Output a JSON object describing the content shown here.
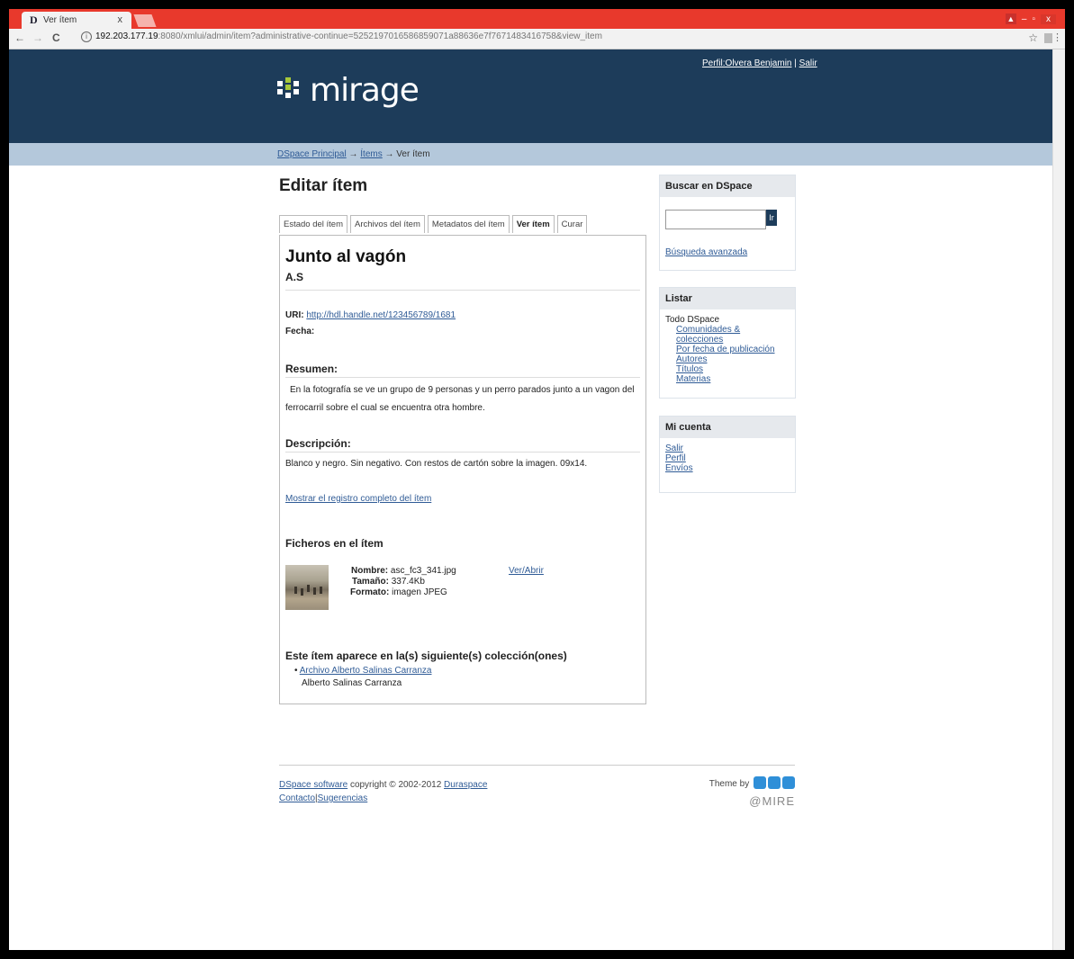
{
  "browser": {
    "tab_title": "Ver ítem",
    "tab_favicon": "D",
    "tab_close": "x",
    "url_host": "192.203.177.19",
    "url_rest": ":8080/xmlui/admin/item?administrative-continue=5252197016586859071a88636e7f7671483416758&view_item",
    "back": "←",
    "forward": "→",
    "reload": "C",
    "star": "☆",
    "menu": "⋮",
    "win_min": "–",
    "win_max": "▫",
    "win_close": "x",
    "colors": {
      "titlebar": "#e8392c",
      "header": "#1d3c5a",
      "trail": "#b4c8db"
    }
  },
  "header": {
    "logo_text": "mirage",
    "profile_link": "Perfil:Olvera Benjamin",
    "separator": "|",
    "logout_link": "Salir"
  },
  "trail": {
    "home": "DSpace Principal",
    "arrow": "→",
    "items": "Ítems",
    "current": "Ver ítem"
  },
  "main": {
    "title": "Editar ítem",
    "tabs": [
      {
        "label": "Estado del ítem"
      },
      {
        "label": "Archivos del ítem"
      },
      {
        "label": "Metadatos del ítem"
      },
      {
        "label": "Ver ítem"
      },
      {
        "label": "Curar"
      }
    ],
    "item_title": "Junto al vagón",
    "item_author": "A.S",
    "uri_label": "URI:",
    "uri_value": "http://hdl.handle.net/123456789/1681",
    "date_label": "Fecha:",
    "abstract_heading": "Resumen:",
    "abstract_text": "En la fotografía se ve un grupo de 9 personas y un perro parados junto a un vagon del ferrocarril sobre el cual se encuentra otra hombre.",
    "description_heading": "Descripción:",
    "description_text": "Blanco y negro. Sin negativo. Con restos de cartón sobre la imagen. 09x14.",
    "full_record_link": "Mostrar el registro completo del ítem",
    "files_heading": "Ficheros en el ítem",
    "file": {
      "name_label": "Nombre:",
      "name_value": "asc_fc3_341.jpg",
      "size_label": "Tamaño:",
      "size_value": "337.4Kb",
      "format_label": "Formato:",
      "format_value": "imagen JPEG",
      "open_link": "Ver/Abrir"
    },
    "collections_heading": "Este ítem aparece en la(s) siguiente(s) colección(ones)",
    "collection_link": "Archivo Alberto Salinas Carranza",
    "collection_desc": "Alberto Salinas Carranza"
  },
  "sidebar": {
    "search_heading": "Buscar en DSpace",
    "search_button": "Ir",
    "advanced_search": "Búsqueda avanzada",
    "browse_heading": "Listar",
    "browse_all": "Todo DSpace",
    "browse_items": [
      "Comunidades & colecciones",
      "Por fecha de publicación",
      "Autores",
      "Títulos",
      "Materias"
    ],
    "account_heading": "Mi cuenta",
    "account_items": [
      "Salir",
      "Perfil",
      "Envíos"
    ]
  },
  "footer": {
    "software_link": "DSpace software",
    "copyright": "copyright © 2002-2012",
    "duraspace_link": "Duraspace",
    "contact_link": "Contacto",
    "separator": "|",
    "feedback_link": "Sugerencias",
    "theme_by": "Theme by",
    "mire_text": "@MIRE"
  }
}
